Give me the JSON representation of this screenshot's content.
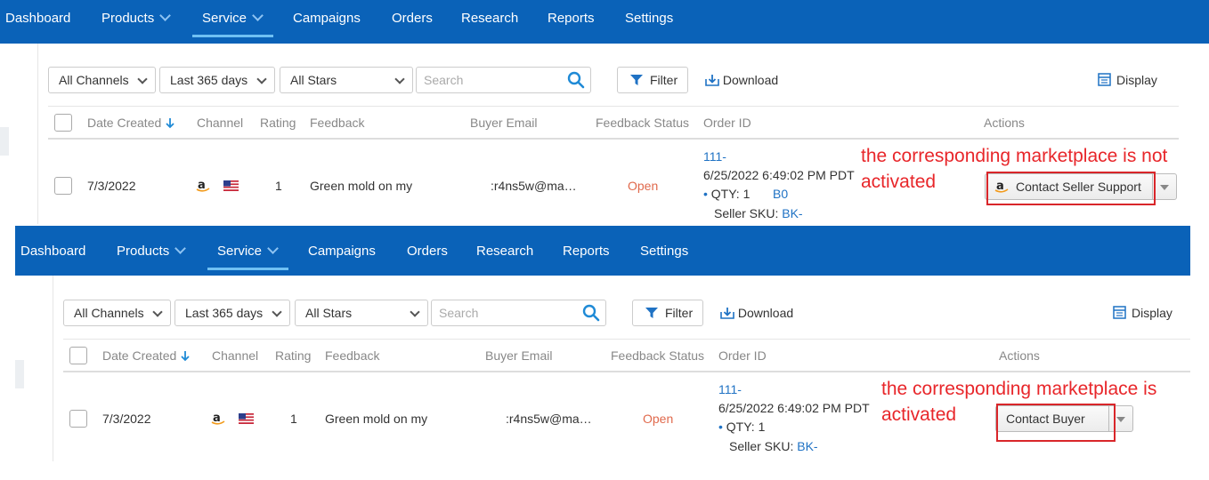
{
  "nav": {
    "items": [
      "Dashboard",
      "Products",
      "Service",
      "Campaigns",
      "Orders",
      "Research",
      "Reports",
      "Settings"
    ],
    "active": "Service"
  },
  "toolbar": {
    "channels": "All Channels",
    "period": "Last 365 days",
    "stars": "All Stars",
    "search_placeholder": "Search",
    "filter_label": "Filter",
    "download_label": "Download",
    "display_label": "Display"
  },
  "table": {
    "columns": [
      "Date Created",
      "Channel",
      "Rating",
      "Feedback",
      "Buyer Email",
      "Feedback Status",
      "Order ID",
      "Actions"
    ],
    "row": {
      "date": "7/3/2022",
      "rating": "1",
      "feedback": "Green mold on my",
      "buyer_email": ":r4ns5w@ma…",
      "status": "Open",
      "order_id": "111-",
      "order_date": "6/25/2022 6:49:02 PM PDT",
      "qty": "QTY: 1",
      "asin": "B0",
      "sku_label": "Seller SKU:",
      "sku": "BK-"
    }
  },
  "panel_top": {
    "annotation_line1": "the corresponding marketplace is not",
    "annotation_line2": "activated",
    "action_label": "Contact Seller Support"
  },
  "panel_bottom": {
    "annotation_line1": "the corresponding marketplace is",
    "annotation_line2": "activated",
    "action_label": "Contact Buyer"
  },
  "colors": {
    "nav_bg": "#0a62b8",
    "active_underline": "#6fc0f3",
    "status_open": "#e0694c",
    "link": "#1f72c4",
    "annotation": "#e8262a"
  },
  "icons": {
    "dropdown": "chevron-down-icon",
    "search": "magnifier-icon",
    "filter": "funnel-icon",
    "download": "download-tray-icon",
    "display": "table-settings-icon",
    "sort": "arrow-down-icon",
    "channel": "amazon-logo-icon",
    "flag": "us-flag-icon"
  }
}
